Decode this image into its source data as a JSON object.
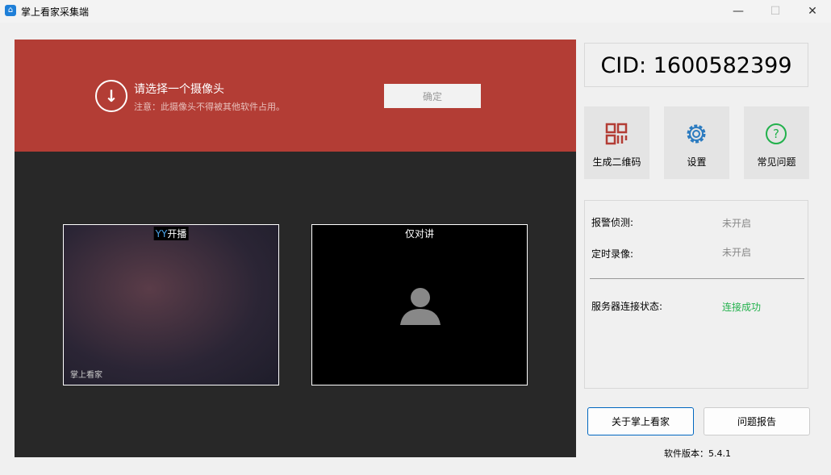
{
  "window": {
    "title": "掌上看家采集端",
    "minimize": "—",
    "maximize": "☐",
    "close": "✕"
  },
  "banner": {
    "title": "请选择一个摄像头",
    "note": "注意：此摄像头不得被其他软件占用。",
    "confirm": "确定"
  },
  "tiles": [
    {
      "label_prefix": "YY",
      "label": "开播",
      "watermark": "掌上看家"
    },
    {
      "label": "仅对讲"
    }
  ],
  "cid": "CID: 1600582399",
  "features": [
    {
      "label": "生成二维码",
      "color": "#b33d35"
    },
    {
      "label": "设置",
      "color": "#2b7bc0"
    },
    {
      "label": "常见问题",
      "color": "#22b14c"
    }
  ],
  "status": {
    "alarm_label": "报警侦测:",
    "alarm_value": "未开启",
    "record_label": "定时录像:",
    "record_value": "未开启",
    "server_label": "服务器连接状态:",
    "server_value": "连接成功",
    "server_color": "#22b14c"
  },
  "about": "关于掌上看家",
  "report": "问题报告",
  "version": "软件版本：5.4.1"
}
